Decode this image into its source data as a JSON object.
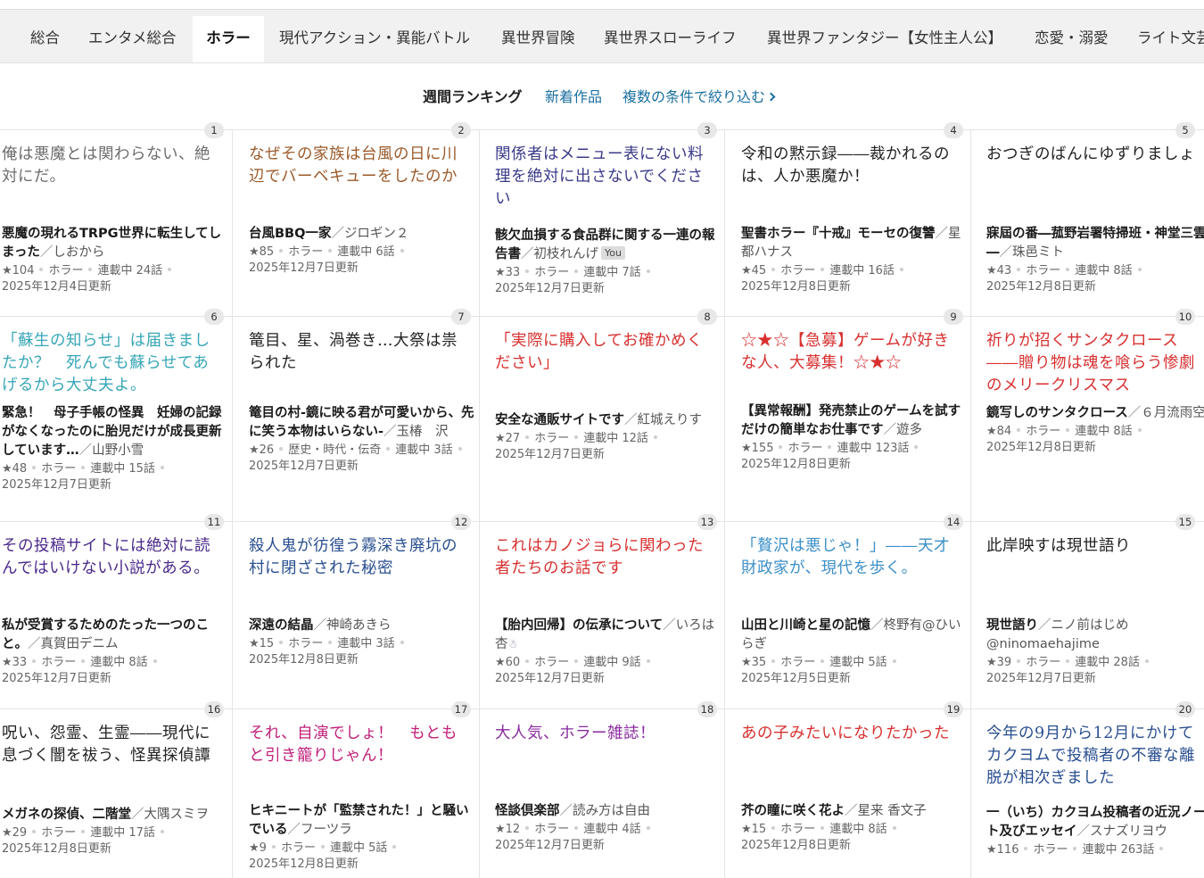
{
  "genre_tabs": [
    {
      "label": "総合"
    },
    {
      "label": "エンタメ総合"
    },
    {
      "label": "ホラー"
    },
    {
      "label": "現代アクション・異能バトル"
    },
    {
      "label": "異世界冒険"
    },
    {
      "label": "異世界スローライフ"
    },
    {
      "label": "異世界ファンタジー【女性主人公】"
    },
    {
      "label": "恋愛・溺愛"
    },
    {
      "label": "ライト文芸"
    }
  ],
  "active_tab": "ホラー",
  "subnav": {
    "current": "週間ランキング",
    "new_works": "新着作品",
    "filter": "複数の条件で絞り込む"
  },
  "colors": {
    "link": "#1a6fa0",
    "gray_catch": "#6e6e6e",
    "brown_catch": "#9a5a2a",
    "navy_catch": "#3b3b8a",
    "black_catch": "#222222",
    "teal_catch": "#37a6b7",
    "red_catch": "#d83030",
    "blue_catch": "#2a4f90",
    "purple_catch": "#4a2a8a",
    "skyblue_catch": "#3c8fc8",
    "magenta_catch": "#c0207a",
    "violet_catch": "#8a2aa0"
  },
  "rankings": [
    {
      "rank": "1",
      "catch": "俺は悪魔とは関わらない、絶対にだ。",
      "color": "#6e6e6e",
      "title": "悪魔の現れるTRPG世界に転生してしまった",
      "author": "しおから",
      "stars": "★104",
      "genre": "ホラー",
      "status": "連載中 24話",
      "updated": "2025年12月4日更新"
    },
    {
      "rank": "2",
      "catch": "なぜその家族は台風の日に川辺でバーベキューをしたのか",
      "color": "#9a5a2a",
      "title": "台風BBQ一家",
      "author": "ジロギン２",
      "stars": "★85",
      "genre": "ホラー",
      "status": "連載中 6話",
      "updated": "2025年12月7日更新"
    },
    {
      "rank": "3",
      "catch": "関係者はメニュー表にない料理を絶対に出さないでください",
      "color": "#3b3b8a",
      "title": "骸欠血損する食品群に関する一連の報告書",
      "author": "初枝れんげ",
      "badge": "You",
      "stars": "★33",
      "genre": "ホラー",
      "status": "連載中 7話",
      "updated": "2025年12月7日更新"
    },
    {
      "rank": "4",
      "catch": "令和の黙示録――裁かれるのは、人か悪魔か！",
      "color": "#222222",
      "title": "聖書ホラー『十戒』モーセの復讐",
      "author": "星都ハナス",
      "stars": "★45",
      "genre": "ホラー",
      "status": "連載中 16話",
      "updated": "2025年12月8日更新"
    },
    {
      "rank": "5",
      "catch": "おつぎのばんにゆずりましょ",
      "color": "#222222",
      "title": "寐屆の番―菰野岩署特掃班・神堂三雲―",
      "author": "珠邑ミト",
      "stars": "★43",
      "genre": "ホラー",
      "status": "連載中 8話",
      "updated": "2025年12月8日更新"
    },
    {
      "rank": "6",
      "catch": "「蘇生の知らせ」は届きましたか？　死んでも蘇らせてあげるから大丈夫よ。",
      "color": "#37a6b7",
      "title": "緊急！　母子手帳の怪異　妊婦の記録がなくなったのに胎児だけが成長更新しています…",
      "author": "山野小雪",
      "stars": "★48",
      "genre": "ホラー",
      "status": "連載中 15話",
      "updated": "2025年12月7日更新"
    },
    {
      "rank": "7",
      "catch": "篭目、星、渦巻き…大祭は祟られた",
      "color": "#222222",
      "title": "篭目の村-鏡に映る君が可愛いから、先に笑う本物はいらない-",
      "author": "玉椿　沢",
      "stars": "★26",
      "genre": "歴史・時代・伝奇",
      "status": "連載中 3話",
      "updated": "2025年12月7日更新"
    },
    {
      "rank": "8",
      "catch": "「実際に購入してお確かめください」",
      "color": "#d83030",
      "title": "安全な通販サイトです",
      "author": "紅城えりす",
      "stars": "★27",
      "genre": "ホラー",
      "status": "連載中 12話",
      "updated": "2025年12月7日更新"
    },
    {
      "rank": "9",
      "catch": "☆★☆【急募】ゲームが好きな人、大募集！☆★☆",
      "color": "#d83030",
      "title": "【異常報酬】発売禁止のゲームを試すだけの簡単なお仕事です",
      "author": "遊多",
      "stars": "★155",
      "genre": "ホラー",
      "status": "連載中 123話",
      "updated": "2025年12月8日更新"
    },
    {
      "rank": "10",
      "catch": "祈りが招くサンタクロース――贈り物は魂を喰らう惨劇のメリークリスマス",
      "color": "#d83030",
      "title": "鏡写しのサンタクロース",
      "author": "６月流雨空",
      "stars": "★84",
      "genre": "ホラー",
      "status": "連載中 8話",
      "updated": "2025年12月8日更新"
    },
    {
      "rank": "11",
      "catch": "その投稿サイトには絶対に読んではいけない小説がある。",
      "color": "#4a2a8a",
      "title": "私が受賞するためのたった一つのこと。",
      "author": "真賀田デニム",
      "stars": "★33",
      "genre": "ホラー",
      "status": "連載中 8話",
      "updated": "2025年12月7日更新"
    },
    {
      "rank": "12",
      "catch": "殺人鬼が彷徨う霧深き廃坑の村に閉ざされた秘密",
      "color": "#2a4f90",
      "title": "深遠の結晶",
      "author": "神崎あきら",
      "stars": "★15",
      "genre": "ホラー",
      "status": "連載中 3話",
      "updated": "2025年12月8日更新"
    },
    {
      "rank": "13",
      "catch": "これはカノジョらに関わった者たちのお話です",
      "color": "#d83030",
      "title": "【胎内回帰】の伝承について",
      "author": "いろは杏",
      "icon": "snowman-icon",
      "stars": "★60",
      "genre": "ホラー",
      "status": "連載中 9話",
      "updated": "2025年12月7日更新"
    },
    {
      "rank": "14",
      "catch": "「贅沢は悪じゃ！」――天才財政家が、現代を歩く。",
      "color": "#3c8fc8",
      "title": "山田と川崎と星の記憶",
      "author": "柊野有@ひいらぎ",
      "stars": "★35",
      "genre": "ホラー",
      "status": "連載中 5話",
      "updated": "2025年12月5日更新"
    },
    {
      "rank": "15",
      "catch": "此岸映すは現世語り",
      "color": "#222222",
      "title": "現世語り",
      "author": "ニノ前はじめ@ninomaehajime",
      "stars": "★39",
      "genre": "ホラー",
      "status": "連載中 28話",
      "updated": "2025年12月7日更新"
    },
    {
      "rank": "16",
      "catch": "呪い、怨霊、生霊――現代に息づく闇を祓う、怪異探偵譚",
      "color": "#222222",
      "title": "メガネの探偵、二階堂",
      "author": "大隅スミヲ",
      "stars": "★29",
      "genre": "ホラー",
      "status": "連載中 17話",
      "updated": "2025年12月8日更新"
    },
    {
      "rank": "17",
      "catch": "それ、自演でしょ！　もともと引き籠りじゃん！",
      "color": "#c0207a",
      "title": "ヒキニートが「監禁された！」と騒いでいる",
      "author": "フーツラ",
      "stars": "★9",
      "genre": "ホラー",
      "status": "連載中 5話",
      "updated": "2025年12月8日更新"
    },
    {
      "rank": "18",
      "catch": "大人気、ホラー雑誌！",
      "color": "#8a2aa0",
      "title": "怪談倶楽部",
      "author": "読み方は自由",
      "stars": "★12",
      "genre": "ホラー",
      "status": "連載中 4話",
      "updated": "2025年12月7日更新"
    },
    {
      "rank": "19",
      "catch": "あの子みたいになりたかった",
      "color": "#d83030",
      "title": "芥の瞳に咲く花よ",
      "author": "星来 香文子",
      "stars": "★15",
      "genre": "ホラー",
      "status": "連載中 8話",
      "updated": "2025年12月8日更新"
    },
    {
      "rank": "20",
      "catch": "今年の9月から12月にかけてカクヨムで投稿者の不審な離脱が相次ぎました",
      "color": "#2a4f90",
      "title": "一（いち）カクヨム投稿者の近況ノート及びエッセイ",
      "author": "スナズリヨウ",
      "stars": "★116",
      "genre": "ホラー",
      "status": "連載中 263話",
      "updated": ""
    }
  ]
}
